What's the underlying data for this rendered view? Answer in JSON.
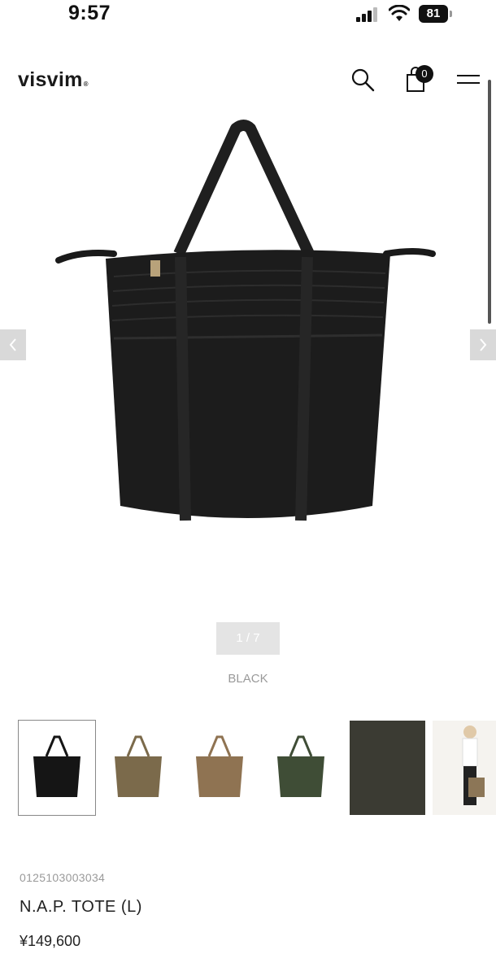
{
  "status_bar": {
    "time": "9:57",
    "battery_level": "81",
    "icons": [
      "signal-icon",
      "wifi-icon",
      "battery-icon"
    ]
  },
  "header": {
    "logo_text": "visvim",
    "logo_mark": "®",
    "cart_count": "0",
    "icons": [
      "search-icon",
      "cart-icon",
      "menu-icon"
    ]
  },
  "gallery": {
    "page_indicator": "1 / 7",
    "color_name": "BLACK",
    "prev_icon": "chevron-left-icon",
    "next_icon": "chevron-right-icon",
    "thumbnail_colors": [
      "#151515",
      "#7b6a4b",
      "#8f7352",
      "#3f4d36",
      "#3b3b33",
      "#e8e3db"
    ]
  },
  "product": {
    "code": "0125103003034",
    "name": "N.A.P. TOTE (L)",
    "price": "¥149,600"
  },
  "colors": {
    "bag_main": "#1c1c1c",
    "bag_handle": "#232323",
    "arrow_bg": "#d9d9d9"
  }
}
